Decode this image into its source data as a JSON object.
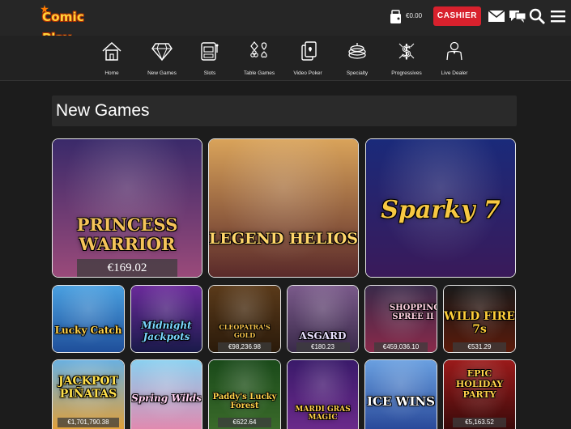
{
  "header": {
    "logo_text": "Comic Play",
    "balance": "€0.00",
    "cashier_label": "CASHIER",
    "icons": [
      "wallet-icon",
      "mail-icon",
      "chat-icon",
      "search-icon",
      "menu-icon"
    ]
  },
  "nav": {
    "items": [
      {
        "label": "Home",
        "icon": "home-icon"
      },
      {
        "label": "New Games",
        "icon": "diamond-icon"
      },
      {
        "label": "Slots",
        "icon": "slot-machine-icon"
      },
      {
        "label": "Table Games",
        "icon": "card-suits-icon"
      },
      {
        "label": "Video Poker",
        "icon": "cards-icon"
      },
      {
        "label": "Specialty",
        "icon": "chips-icon"
      },
      {
        "label": "Progressives",
        "icon": "dollar-icon"
      },
      {
        "label": "Live Dealer",
        "icon": "dealer-icon"
      }
    ]
  },
  "section": {
    "title": "New Games"
  },
  "featured": [
    {
      "name": "PRINCESS WARRIOR",
      "jackpot": "€169.02",
      "color_top": "#3a2a6a",
      "color_bottom": "#9a4a7a",
      "title_color": "#f5c35a"
    },
    {
      "name": "LEGEND HELIOS",
      "jackpot": "",
      "color_top": "#d9a35a",
      "color_bottom": "#5a2a2a",
      "title_color": "#ffd66a"
    },
    {
      "name": "Sparky 7",
      "jackpot": "",
      "color_top": "#1a2a7a",
      "color_bottom": "#3a1a5a",
      "title_color": "#f7c842"
    }
  ],
  "games_row1": [
    {
      "name": "Lucky Catch",
      "jackpot": "",
      "color_top": "#4aa0e0",
      "color_bottom": "#1f4f9a",
      "title_color": "#ffd24a"
    },
    {
      "name": "Midnight Jackpots",
      "jackpot": "",
      "color_top": "#6a2a9a",
      "color_bottom": "#1a1a4a",
      "title_color": "#7ad6ff"
    },
    {
      "name": "CLEOPATRA'S GOLD",
      "jackpot": "€98,236.98",
      "color_top": "#5a3a1a",
      "color_bottom": "#2a1a0a",
      "title_color": "#f3c04a"
    },
    {
      "name": "ASGARD",
      "jackpot": "€180.23",
      "color_top": "#7a5a8a",
      "color_bottom": "#3a2a4a",
      "title_color": "#e9e0ff"
    },
    {
      "name": "SHOPPING SPREE II",
      "jackpot": "€459,036.10",
      "color_top": "#3a2a4a",
      "color_bottom": "#8a2a4a",
      "title_color": "#ffd0e0"
    },
    {
      "name": "WILD FIRE 7s",
      "jackpot": "€531.29",
      "color_top": "#1a1a1a",
      "color_bottom": "#5a1a0a",
      "title_color": "#ffcf3a"
    }
  ],
  "games_row2": [
    {
      "name": "JACKPOT PIÑATAS",
      "jackpot": "€1,701,790.38",
      "color_top": "#6ab0e0",
      "color_bottom": "#e0a03a",
      "title_color": "#ffe04a"
    },
    {
      "name": "Spring Wilds",
      "jackpot": "",
      "color_top": "#8ad0f0",
      "color_bottom": "#e08ab0",
      "title_color": "#ffd0f0"
    },
    {
      "name": "Paddy's Lucky Forest",
      "jackpot": "€622.64",
      "color_top": "#1a4a1a",
      "color_bottom": "#3a6a2a",
      "title_color": "#ffd24a"
    },
    {
      "name": "MARDI GRAS MAGIC",
      "jackpot": "",
      "color_top": "#3a1a6a",
      "color_bottom": "#6a2a8a",
      "title_color": "#ffcf4a"
    },
    {
      "name": "ICE WINS",
      "jackpot": "",
      "color_top": "#6aa0e0",
      "color_bottom": "#2a4a9a",
      "title_color": "#ffffff"
    },
    {
      "name": "EPIC HOLIDAY PARTY",
      "jackpot": "€5,163.52",
      "color_top": "#9a1a1a",
      "color_bottom": "#3a0a0a",
      "title_color": "#ffd24a"
    }
  ]
}
